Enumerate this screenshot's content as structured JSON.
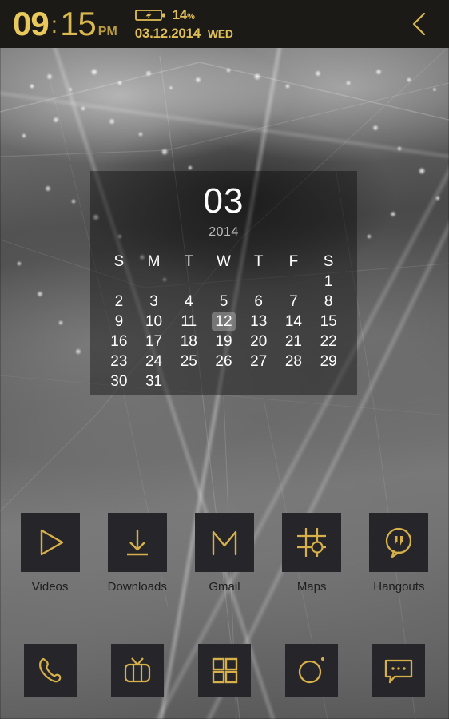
{
  "colors": {
    "gold": "#e0bf55",
    "gold_bright": "#e9c85c",
    "tile_bg": "#26262a",
    "statusbar_bg": "#1c1a17",
    "label_text": "#1e1e1e",
    "today_highlight": "#bebebe"
  },
  "statusbar": {
    "hour": "09",
    "colon": ":",
    "minute": "15",
    "ampm": "PM",
    "battery_icon": "battery-charging-icon",
    "battery_percent": "14",
    "battery_unit": "%",
    "date": "03.12.2014",
    "day_of_week": "WED",
    "back_icon": "chevron-left-icon"
  },
  "calendar": {
    "month": "03",
    "year": "2014",
    "weekday_headers": [
      "S",
      "M",
      "T",
      "W",
      "T",
      "F",
      "S"
    ],
    "today": "12",
    "leading_blanks": 6,
    "days": [
      {
        "n": "1",
        "dim": false
      },
      {
        "n": "2",
        "dim": true
      },
      {
        "n": "3",
        "dim": false
      },
      {
        "n": "4",
        "dim": false
      },
      {
        "n": "5",
        "dim": false
      },
      {
        "n": "6",
        "dim": false
      },
      {
        "n": "7",
        "dim": false
      },
      {
        "n": "8",
        "dim": false
      },
      {
        "n": "9",
        "dim": true
      },
      {
        "n": "10",
        "dim": false
      },
      {
        "n": "11",
        "dim": false
      },
      {
        "n": "12",
        "dim": false
      },
      {
        "n": "13",
        "dim": false
      },
      {
        "n": "14",
        "dim": false
      },
      {
        "n": "15",
        "dim": false
      },
      {
        "n": "16",
        "dim": true
      },
      {
        "n": "17",
        "dim": false
      },
      {
        "n": "18",
        "dim": false
      },
      {
        "n": "19",
        "dim": false
      },
      {
        "n": "20",
        "dim": false
      },
      {
        "n": "21",
        "dim": false
      },
      {
        "n": "22",
        "dim": false
      },
      {
        "n": "23",
        "dim": true
      },
      {
        "n": "24",
        "dim": false
      },
      {
        "n": "25",
        "dim": false
      },
      {
        "n": "26",
        "dim": false
      },
      {
        "n": "27",
        "dim": false
      },
      {
        "n": "28",
        "dim": false
      },
      {
        "n": "29",
        "dim": false
      },
      {
        "n": "30",
        "dim": true
      },
      {
        "n": "31",
        "dim": false
      }
    ]
  },
  "apps": [
    {
      "label": "Videos",
      "icon": "play-triangle-icon"
    },
    {
      "label": "Downloads",
      "icon": "download-arrow-icon"
    },
    {
      "label": "Gmail",
      "icon": "gmail-m-icon"
    },
    {
      "label": "Maps",
      "icon": "map-grid-pin-icon"
    },
    {
      "label": "Hangouts",
      "icon": "speech-bubble-quote-icon"
    }
  ],
  "dock": [
    {
      "name": "Phone",
      "icon": "phone-handset-icon"
    },
    {
      "name": "TV",
      "icon": "television-icon"
    },
    {
      "name": "App Drawer",
      "icon": "app-drawer-grid-icon"
    },
    {
      "name": "Camera",
      "icon": "camera-lens-icon"
    },
    {
      "name": "Messaging",
      "icon": "message-bubble-dots-icon"
    }
  ]
}
